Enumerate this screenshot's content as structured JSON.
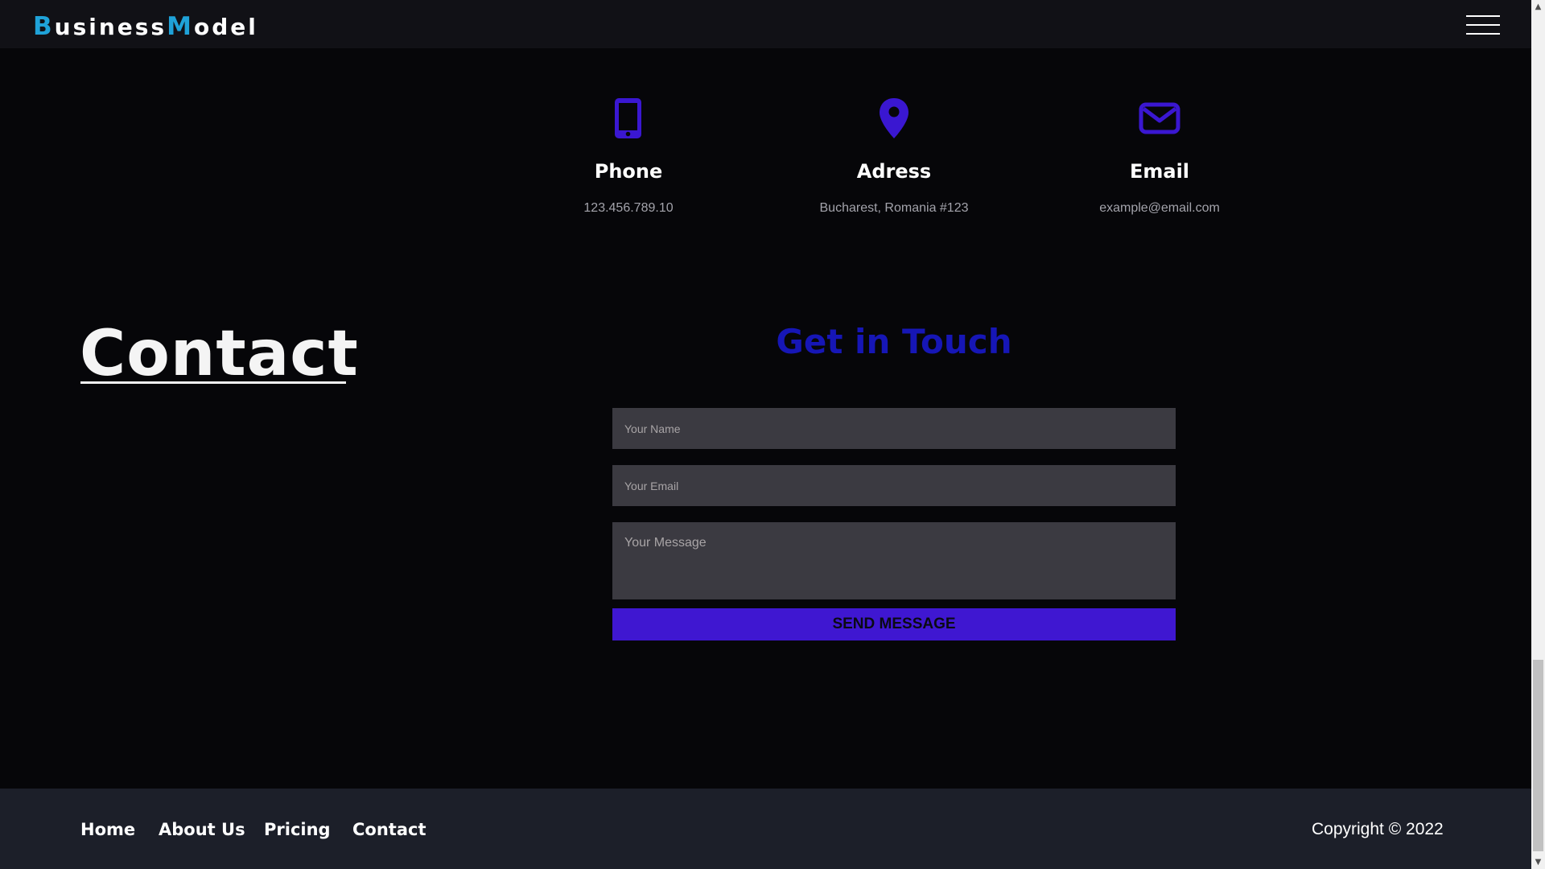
{
  "header": {
    "brand_b": "B",
    "brand_mid": "usiness",
    "brand_m": "M",
    "brand_end": "odel",
    "menu_icon": "hamburger-menu-icon"
  },
  "info": {
    "phone": {
      "title": "Phone",
      "value": "123.456.789.10",
      "icon": "phone-icon"
    },
    "address": {
      "title": "Adress",
      "value": "Bucharest, Romania #123",
      "icon": "location-pin-icon"
    },
    "email": {
      "title": "Email",
      "value": "example@email.com",
      "icon": "envelope-icon"
    }
  },
  "page_title": "Contact",
  "form": {
    "heading": "Get in Touch",
    "name_placeholder": "Your Name",
    "email_placeholder": "Your Email",
    "message_placeholder": "Your Message",
    "submit_label": "SEND MESSAGE"
  },
  "footer": {
    "links": [
      "Home",
      "About Us",
      "Pricing",
      "Contact"
    ],
    "copyright": "Copyright © 2022"
  },
  "colors": {
    "accent_icon": "#3a17d1",
    "brand_cap": "#1fa2d8",
    "heading_blue": "#1616b6",
    "button": "#3f17d1",
    "footer_bg": "#1c1f29"
  }
}
